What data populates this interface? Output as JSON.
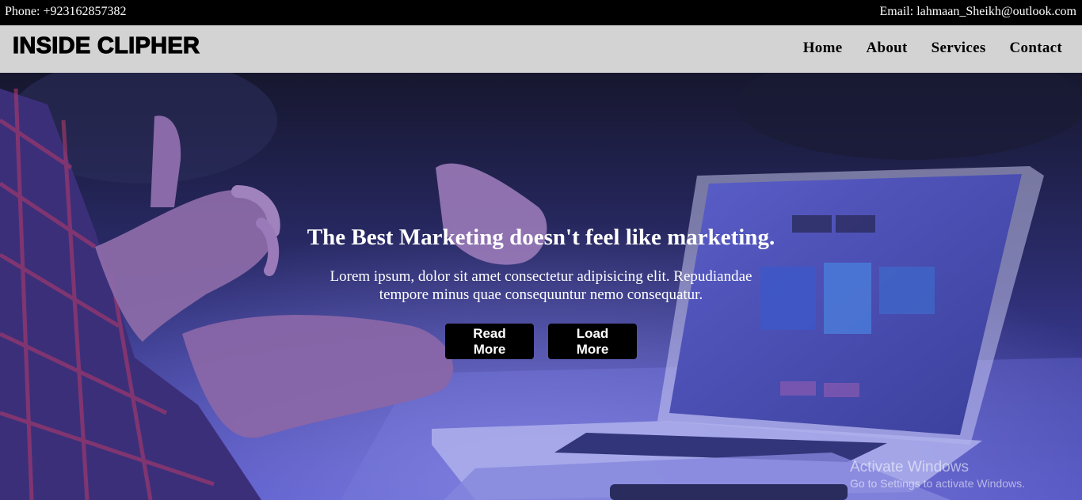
{
  "topbar": {
    "phone": "Phone: +923162857382",
    "email": "Email: lahmaan_Sheikh@outlook.com"
  },
  "brand": {
    "logo": "INSIDE CLIPHER"
  },
  "nav": {
    "items": [
      {
        "label": "Home"
      },
      {
        "label": "About"
      },
      {
        "label": "Services"
      },
      {
        "label": "Contact"
      }
    ]
  },
  "hero": {
    "title": "The Best Marketing doesn't feel like marketing.",
    "text": "Lorem ipsum, dolor sit amet consectetur adipisicing elit. Repudiandae tempore minus quae consequuntur nemo consequatur.",
    "buttons": {
      "read_more": "Read More",
      "load_more": "Load More"
    }
  },
  "watermark": {
    "line1": "Activate Windows",
    "line2": "Go to Settings to activate Windows."
  },
  "colors": {
    "topbar_bg": "#000000",
    "navbar_bg": "#d3d3d3",
    "button_bg": "#000000",
    "hero_overlay": "#2a2a8a"
  }
}
